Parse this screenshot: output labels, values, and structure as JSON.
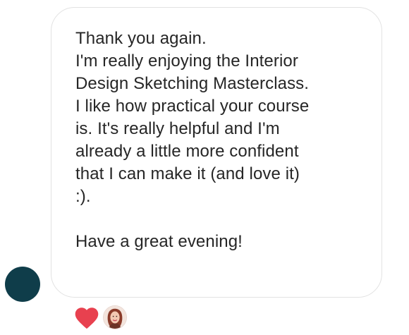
{
  "message": {
    "lines": [
      "Thank you again.",
      "I'm really enjoying the Interior",
      "Design Sketching Masterclass.",
      "I like how practical your course",
      "is. It's really helpful and I'm",
      "already a little more confident",
      "that I can make it (and love it)",
      ":).",
      "",
      "Have a great evening!"
    ]
  },
  "sender": {
    "avatar_color": "#0f3d4a"
  },
  "reactions": {
    "heart_icon": "heart-icon",
    "heart_color": "#e8414f"
  },
  "colors": {
    "text": "#262626",
    "bubble_border": "#e2e2e2",
    "background": "#ffffff"
  }
}
